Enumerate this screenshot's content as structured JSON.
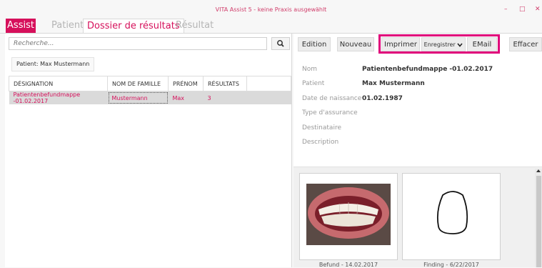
{
  "window": {
    "title": "VITA Assist 5 - keine Praxis ausgewählt",
    "controls": [
      "–",
      "□",
      "✕"
    ]
  },
  "tabs": {
    "brand": "Assist",
    "items": [
      "Patient",
      "Dossier de résultats",
      "Résultat"
    ],
    "active": "Dossier de résultats"
  },
  "left": {
    "search_placeholder": "Recherche...",
    "search_icon": "search-icon",
    "patient_filter": "Patient: Max Mustermann",
    "columns": [
      "DÉSIGNATION",
      "NOM DE FAMILLE",
      "PRÉNOM",
      "RÉSULTATS"
    ],
    "rows": [
      [
        "Patientenbefundmappe -01.02.2017",
        "Mustermann",
        "Max",
        "3"
      ]
    ]
  },
  "toolbar": {
    "edition": "Edition",
    "nouveau": "Nouveau",
    "imprimer": "Imprimer",
    "enregistrer": "Enregistrer",
    "email": "EMail",
    "effacer": "Effacer"
  },
  "details": {
    "nom_label": "Nom",
    "nom_value": "Patientenbefundmappe -01.02.2017",
    "patient_label": "Patient",
    "patient_value": "Max Mustermann",
    "dob_label": "Date de naissance",
    "dob_value": "01.02.1987",
    "insurance_label": "Type d'assurance",
    "recipient_label": "Destinataire",
    "description_label": "Description"
  },
  "thumbnails": [
    {
      "caption": "Befund - 14.02.2017",
      "kind": "teeth-photo"
    },
    {
      "caption": "Finding - 6/22/2017",
      "kind": "tooth-outline-sketch"
    }
  ],
  "colors": {
    "accent": "#d6105b",
    "highlight_box": "#e0007a"
  }
}
